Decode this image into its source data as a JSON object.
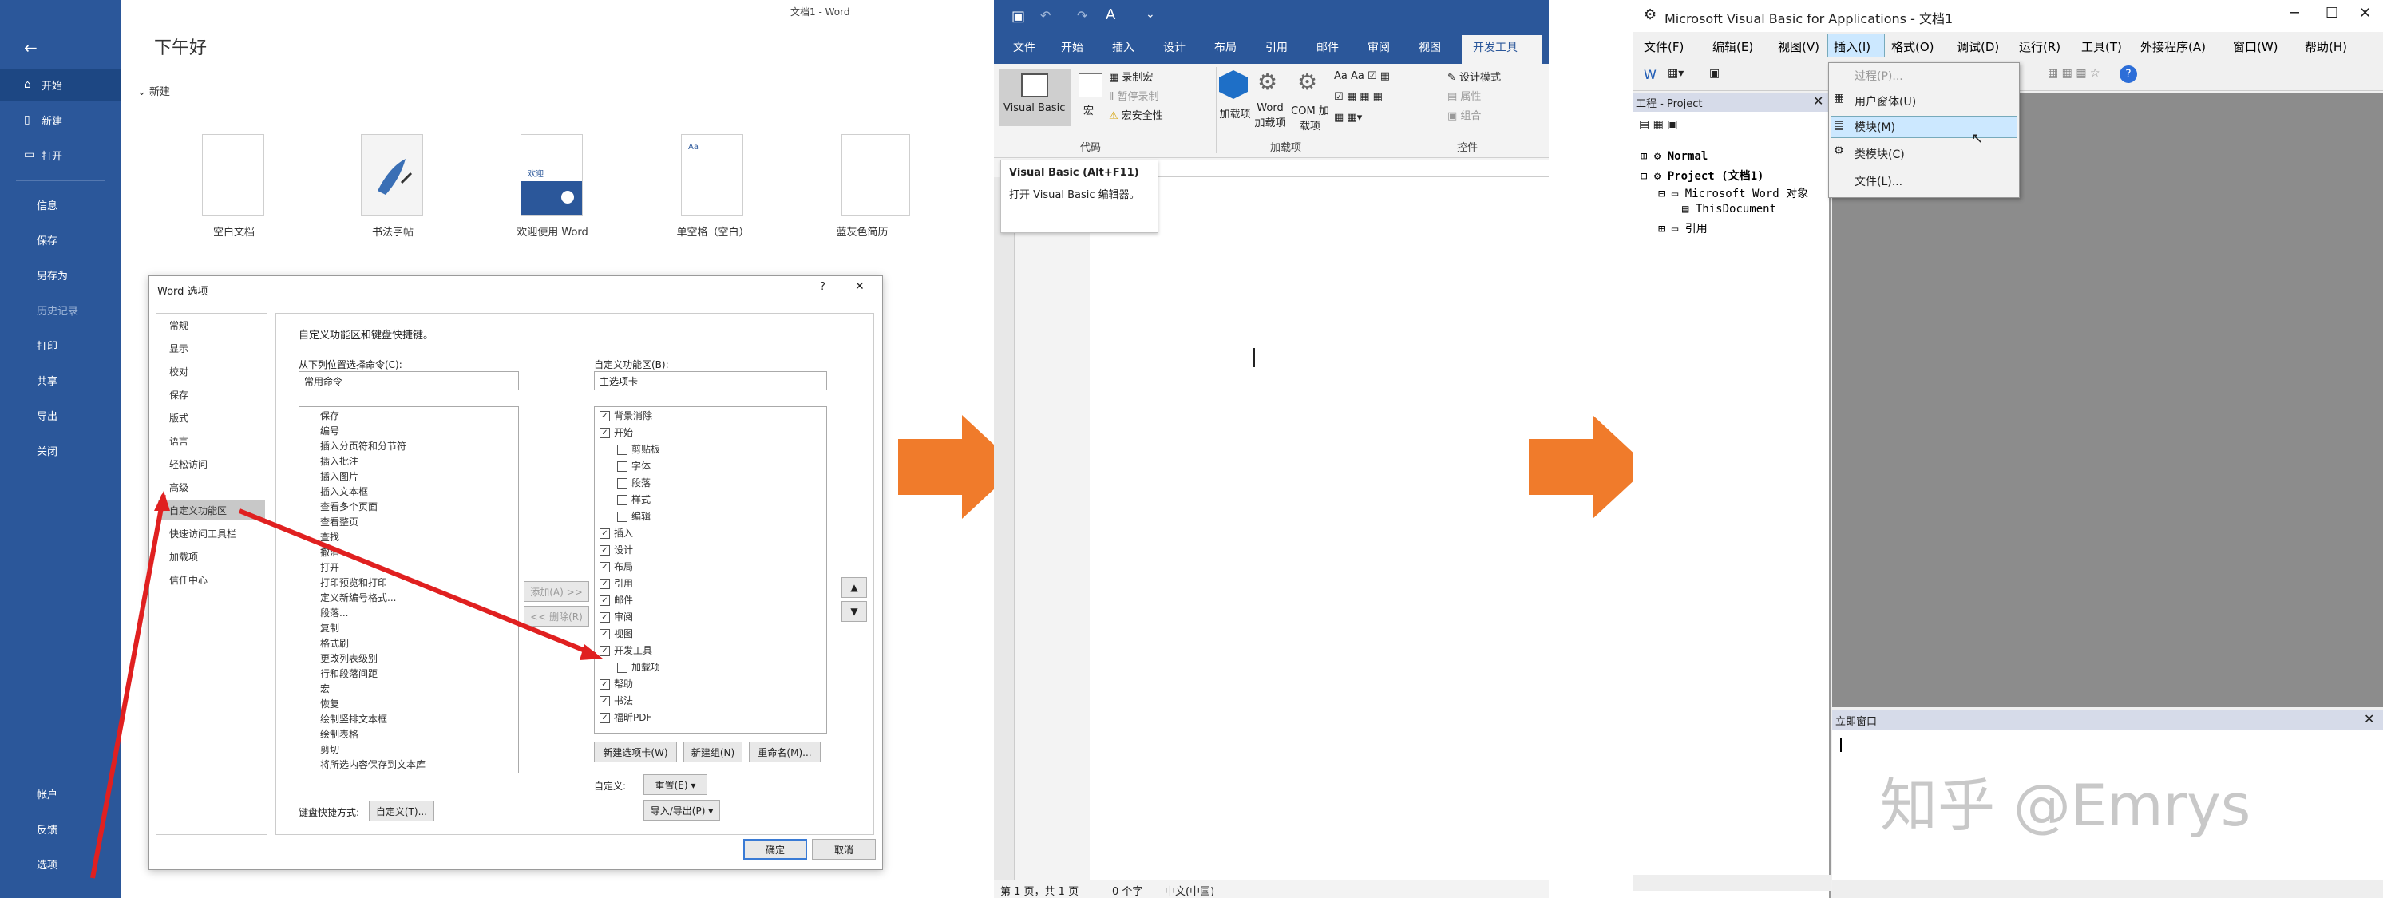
{
  "panel1": {
    "window_title": "文档1 - Word",
    "greeting": "下午好",
    "new_label": "新建",
    "nav": {
      "back": "←",
      "home": "开始",
      "new": "新建",
      "open": "打开",
      "info": "信息",
      "save": "保存",
      "save_as": "另存为",
      "history": "历史记录",
      "print": "打印",
      "share": "共享",
      "export": "导出",
      "close": "关闭",
      "account": "帐户",
      "feedback": "反馈",
      "options": "选项"
    },
    "templates": [
      "空白文档",
      "书法字帖",
      "欢迎使用 Word",
      "单空格（空白）",
      "蓝灰色简历"
    ],
    "welcome_thumb_text": "欢迎",
    "dialog": {
      "title": "Word 选项",
      "help": "?",
      "close": "✕",
      "categories": [
        "常规",
        "显示",
        "校对",
        "保存",
        "版式",
        "语言",
        "轻松访问",
        "高级",
        "自定义功能区",
        "快速访问工具栏",
        "加载项",
        "信任中心"
      ],
      "heading": "自定义功能区和键盘快捷键。",
      "choose_from_label": "从下列位置选择命令(C):",
      "choose_from_value": "常用命令",
      "customize_label": "自定义功能区(B):",
      "customize_value": "主选项卡",
      "commands": [
        "保存",
        "编号",
        "插入分页符和分节符",
        "插入批注",
        "插入图片",
        "插入文本框",
        "查看多个页面",
        "查看整页",
        "查找",
        "撤消",
        "打开",
        "打印预览和打印",
        "定义新编号格式...",
        "段落...",
        "复制",
        "格式刷",
        "更改列表级别",
        "行和段落间距",
        "宏",
        "恢复",
        "绘制竖排文本框",
        "绘制表格",
        "剪切",
        "将所选内容保存到文本库"
      ],
      "tabs_tree": [
        "背景消除",
        "开始",
        "剪贴板",
        "字体",
        "段落",
        "样式",
        "编辑",
        "插入",
        "设计",
        "布局",
        "引用",
        "邮件",
        "审阅",
        "视图",
        "开发工具",
        "加载项",
        "帮助",
        "书法",
        "福昕PDF"
      ],
      "add_btn": "添加(A) >>",
      "remove_btn": "<< 删除(R)",
      "new_tab_btn": "新建选项卡(W)",
      "new_group_btn": "新建组(N)",
      "rename_btn": "重命名(M)...",
      "customize_label2": "自定义:",
      "reset_btn": "重置(E) ▾",
      "import_btn": "导入/导出(P) ▾",
      "keyboard_label": "键盘快捷方式:",
      "keyboard_btn": "自定义(T)...",
      "ok_btn": "确定",
      "cancel_btn": "取消"
    }
  },
  "panel2": {
    "tabs": [
      "文件",
      "开始",
      "插入",
      "设计",
      "布局",
      "引用",
      "邮件",
      "审阅",
      "视图",
      "开发工具"
    ],
    "ribbon": {
      "visual_basic": "Visual Basic",
      "macro": "宏",
      "record_macro": "录制宏",
      "pause_record": "暂停录制",
      "macro_security": "宏安全性",
      "code_group": "代码",
      "word_addins": "Word 加载项",
      "com_addins": "COM 加载项",
      "addins": "加载项",
      "addins_group": "加载项",
      "design_mode": "设计模式",
      "properties": "属性",
      "group": "组合",
      "controls_group": "控件"
    },
    "tooltip": {
      "title": "Visual Basic (Alt+F11)",
      "body": "打开 Visual Basic 编辑器。"
    },
    "status": {
      "page": "第 1 页，共 1 页",
      "words": "0 个字",
      "lang": "中文(中国)"
    }
  },
  "panel3": {
    "title": "Microsoft Visual Basic for Applications - 文档1",
    "menu": [
      "文件(F)",
      "编辑(E)",
      "视图(V)",
      "插入(I)",
      "格式(O)",
      "调试(D)",
      "运行(R)",
      "工具(T)",
      "外接程序(A)",
      "窗口(W)",
      "帮助(H)"
    ],
    "insert_menu": [
      "过程(P)...",
      "用户窗体(U)",
      "模块(M)",
      "类模块(C)",
      "文件(L)..."
    ],
    "project_title": "工程 - Project",
    "tree": [
      "Normal",
      "Project (文档1)",
      "Microsoft Word 对象",
      "ThisDocument",
      "引用"
    ],
    "immediate_title": "立即窗口",
    "watermark": "知乎 @Emrys"
  },
  "colors": {
    "word_blue": "#2b579a",
    "arrow_orange": "#f07b2b",
    "highlight": "#cce8ff",
    "red_arrow": "#e02020"
  }
}
